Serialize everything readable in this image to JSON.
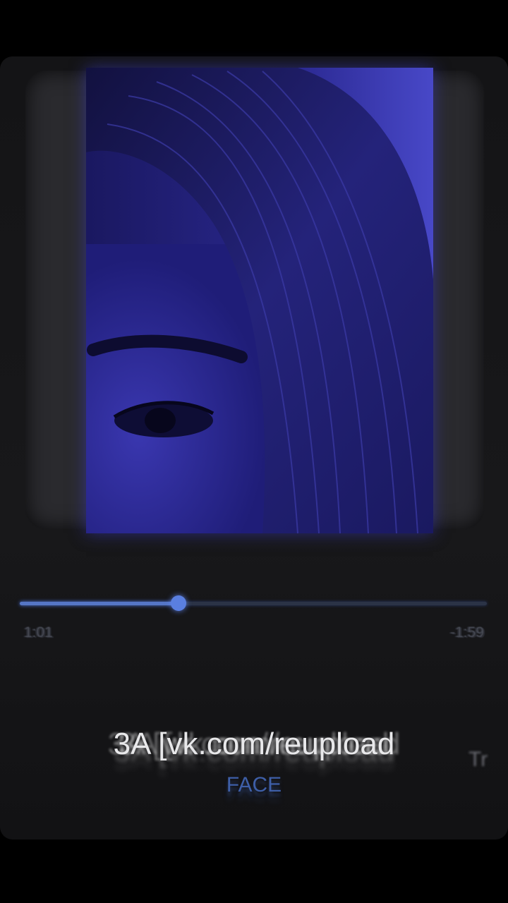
{
  "player": {
    "progress": {
      "elapsed": "1:01",
      "remaining": "-1:59",
      "fraction": 0.34
    },
    "track": {
      "title": "3A [vk.com/reupload",
      "title_overflow_glyph": "Tr",
      "artist": "FACE"
    },
    "colors": {
      "accent": "#5576c6",
      "artwork_tint": "#3f3fc0",
      "background": "#18181a"
    }
  }
}
